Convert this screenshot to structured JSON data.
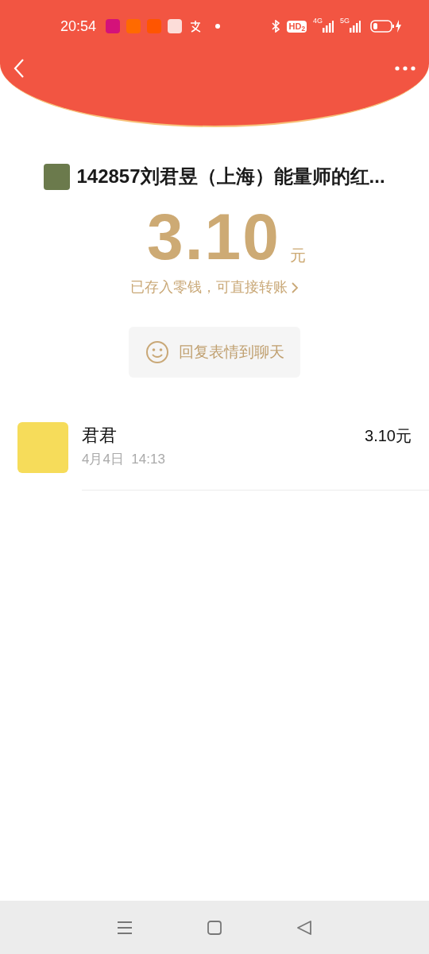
{
  "status_bar": {
    "time": "20:54",
    "hd": "HD$_{2}$",
    "network_1": "4G",
    "network_2": "5G"
  },
  "packet": {
    "title": "142857刘君昱（上海）能量师的红...",
    "amount": "3.10",
    "unit": "元",
    "note": "已存入零钱，可直接转账"
  },
  "reply_button": {
    "label": "回复表情到聊天"
  },
  "records": [
    {
      "name": "君君",
      "time": "4月4日  14:13",
      "amount": "3.10元"
    }
  ]
}
